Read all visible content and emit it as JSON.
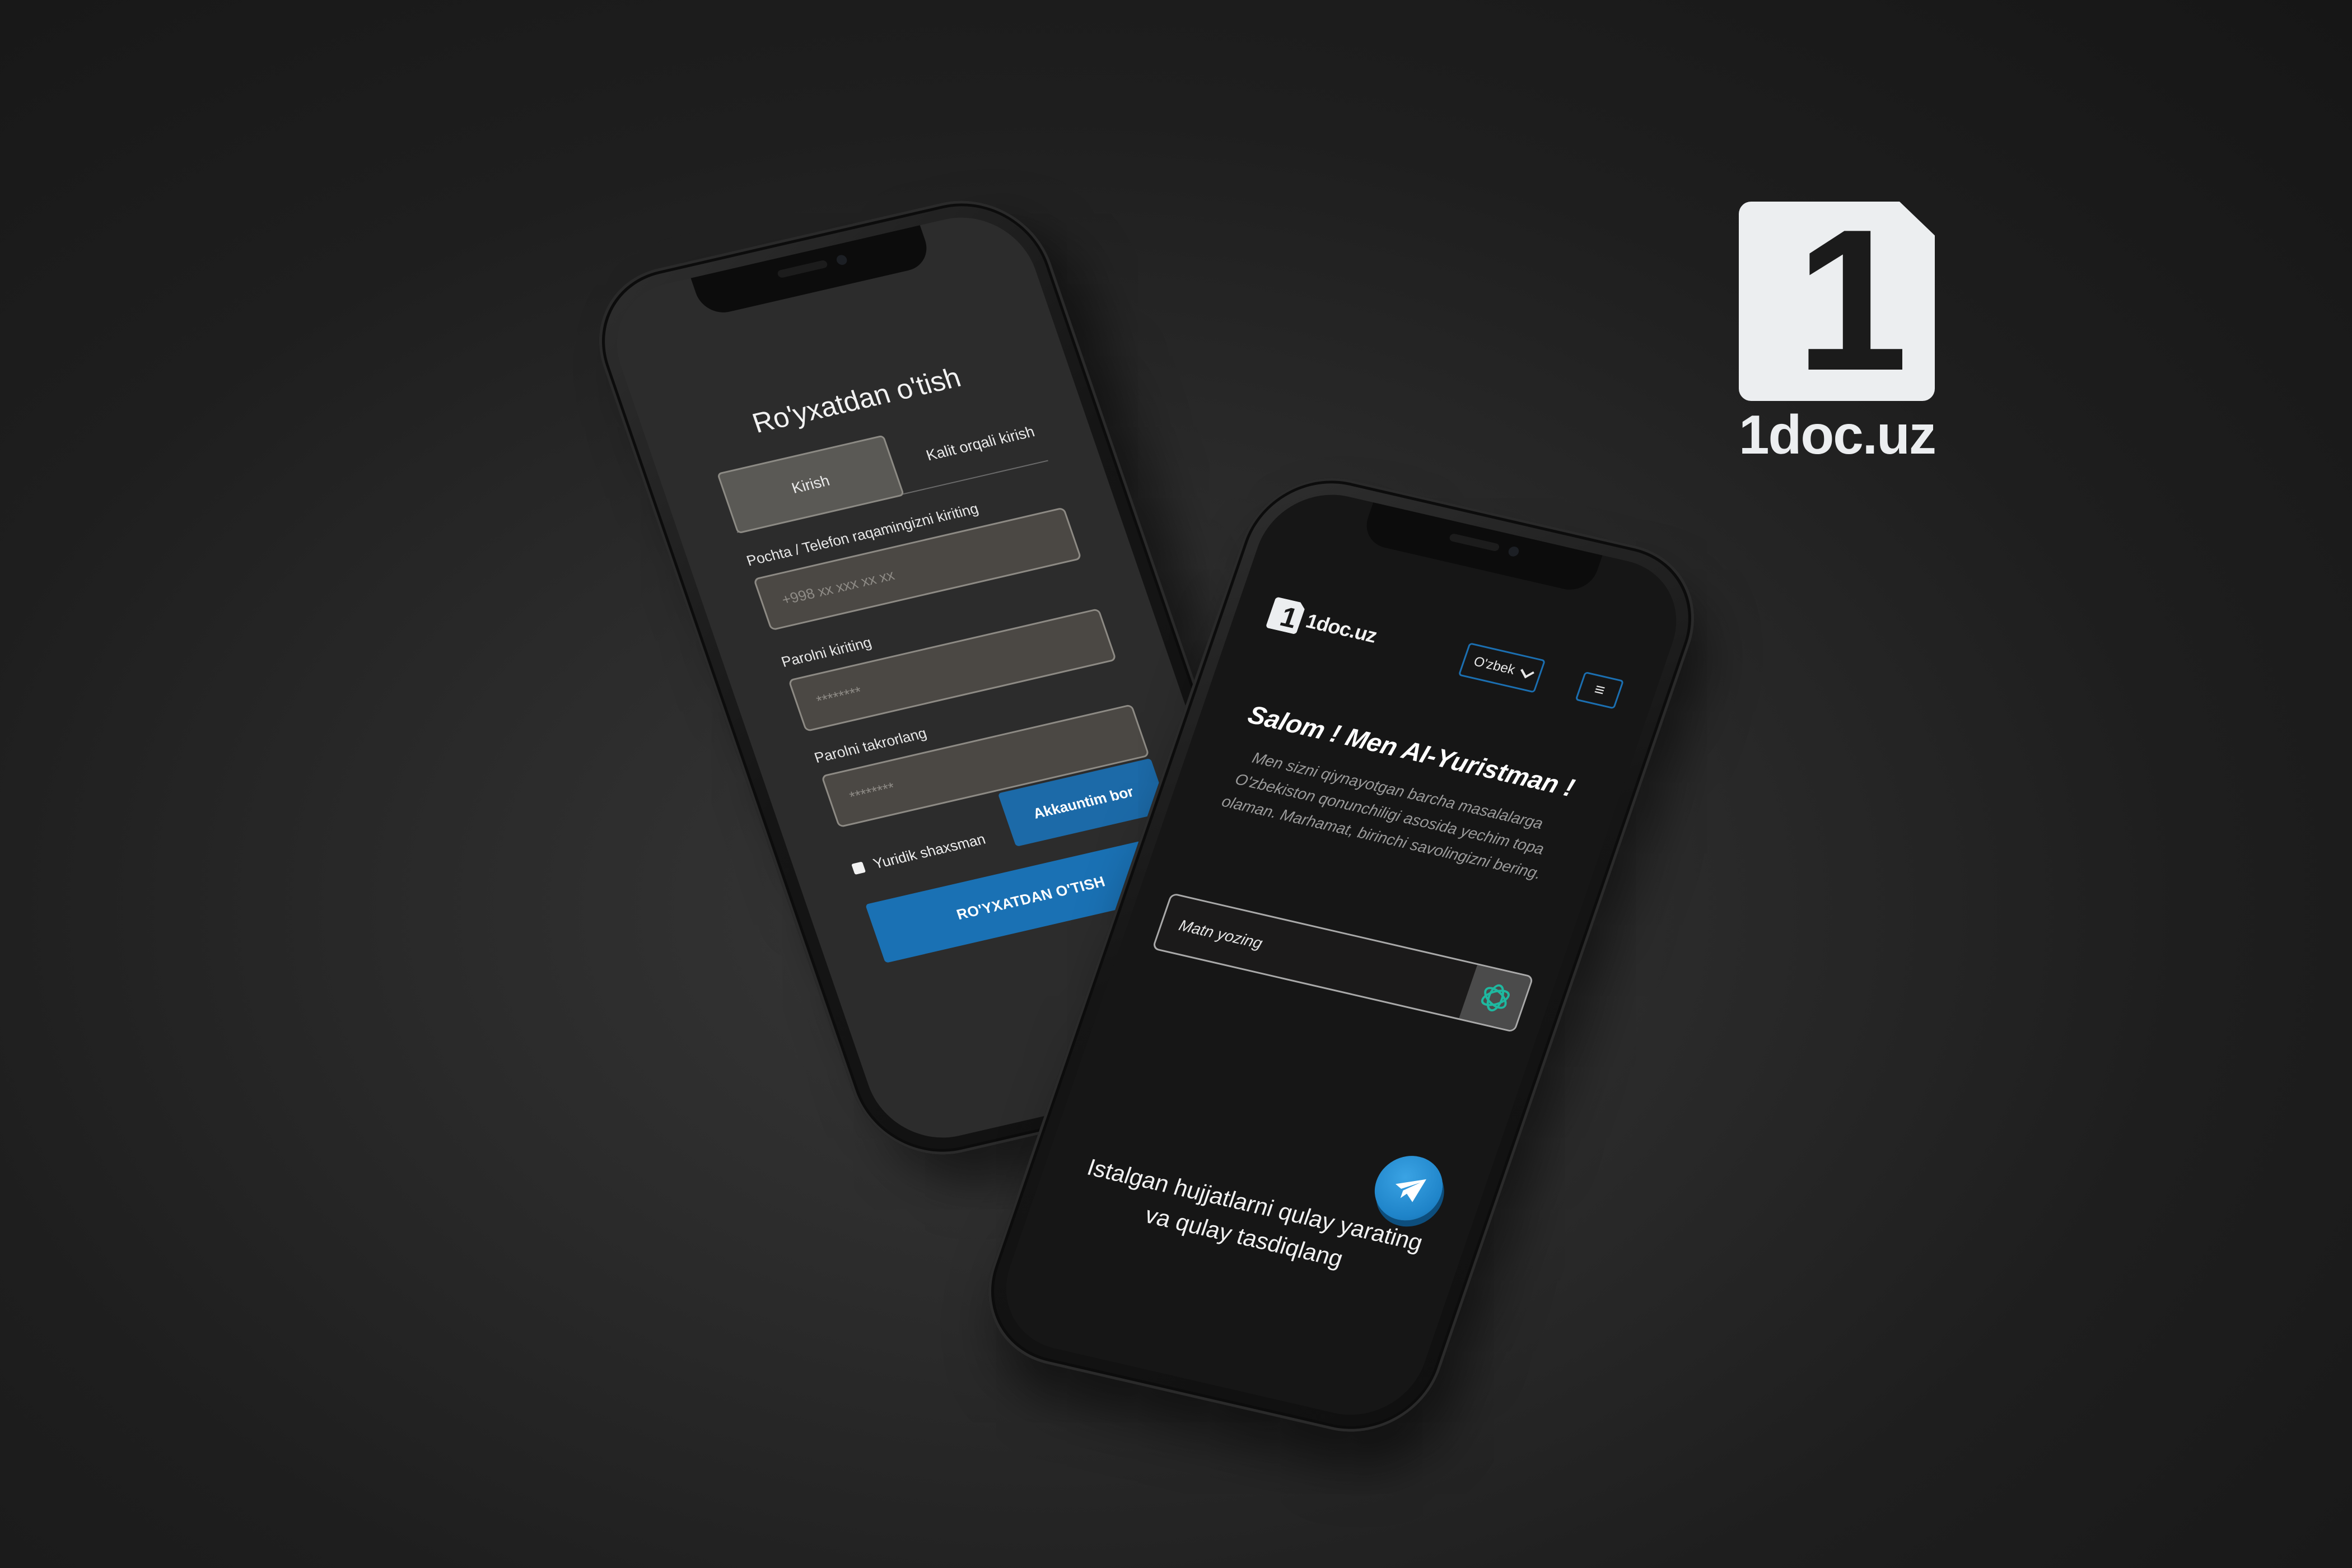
{
  "brand": {
    "digit": "1",
    "name": "1doc.uz"
  },
  "registration": {
    "title": "Ro'yxatdan o'tish",
    "tabs": [
      {
        "label": "Kirish",
        "active": true
      },
      {
        "label": "Kalit orqali kirish",
        "active": false
      }
    ],
    "fields": [
      {
        "label": "Pochta / Telefon raqamingizni kiriting",
        "placeholder": "+998 xx xxx xx xx"
      },
      {
        "label": "Parolni kiriting",
        "placeholder": "********"
      },
      {
        "label": "Parolni takrorlang",
        "placeholder": "********"
      }
    ],
    "checkbox_label": "Yuridik shaxsman",
    "have_account_label": "Akkauntim bor",
    "submit_label": "RO'YXATDAN O'TISH"
  },
  "home": {
    "logo_digit": "1",
    "logo_name": "1doc.uz",
    "language": "O'zbek",
    "menu_glyph": "≡",
    "hero_title": "Salom ! Men AI-Yuristman !",
    "hero_description": "Men sizni qiynayotgan barcha masalalarga O'zbekiston qonunchiligi asosida yechim topa olaman. Marhamat, birinchi savolingizni bering.",
    "input_placeholder": "Matn yozing",
    "tagline_line1": "Istalgan hujjatlarni qulay yarating",
    "tagline_line2": "va qulay tasdiqlang"
  },
  "colors": {
    "accent_blue": "#1a71b4",
    "telegram_blue": "#1e83c8",
    "ai_icon_green": "#1fb8a0"
  },
  "icons": {
    "send": "openai-icon",
    "floating": "telegram-icon",
    "menu": "hamburger-icon",
    "dropdown": "chevron-down-icon"
  }
}
